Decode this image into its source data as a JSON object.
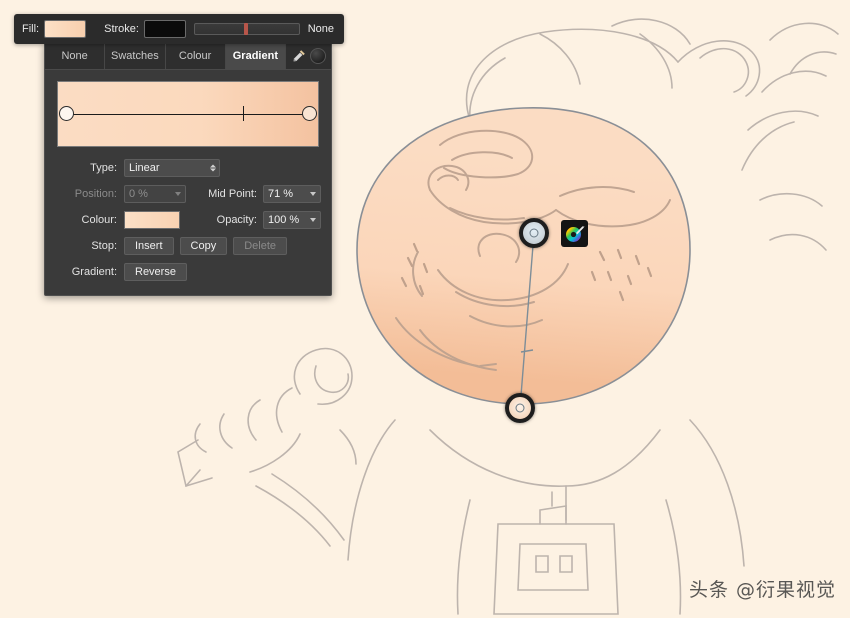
{
  "app": {
    "canvas_background": "#fdf2e3",
    "watermark": "头条 @衍果视觉"
  },
  "toolbar": {
    "fill_label": "Fill:",
    "fill_color": "#f9d2b0",
    "stroke_label": "Stroke:",
    "stroke_color": "#0b0b0b",
    "stroke_width_none_label": "None",
    "stroke_width_value": 47
  },
  "panel": {
    "tabs": [
      {
        "label": "None",
        "active": false
      },
      {
        "label": "Swatches",
        "active": false
      },
      {
        "label": "Colour",
        "active": false
      },
      {
        "label": "Gradient",
        "active": true
      }
    ],
    "tools": {
      "eyedropper": "eyedropper-icon",
      "colour_circle": "colour-circle-icon"
    },
    "gradient_preview": {
      "start_color": "#fbdcc3",
      "end_color": "#f4c2a0",
      "midpoint_percent": 71
    },
    "fields": {
      "type_label": "Type:",
      "type_value": "Linear",
      "position_label": "Position:",
      "position_value": "0 %",
      "position_disabled": true,
      "midpoint_label": "Mid Point:",
      "midpoint_value": "71 %",
      "colour_label": "Colour:",
      "colour_value": "#fbd9bd",
      "opacity_label": "Opacity:",
      "opacity_value": "100 %",
      "stop_label": "Stop:",
      "stop_insert": "Insert",
      "stop_copy": "Copy",
      "stop_delete": "Delete",
      "stop_delete_disabled": true,
      "gradient_label": "Gradient:",
      "gradient_reverse": "Reverse"
    }
  },
  "canvas": {
    "gradient_handle_start": "gradient-start-handle",
    "gradient_handle_end": "gradient-end-handle",
    "palette_button": "colour-palette-button",
    "artwork_description": "character-face-sketch"
  }
}
